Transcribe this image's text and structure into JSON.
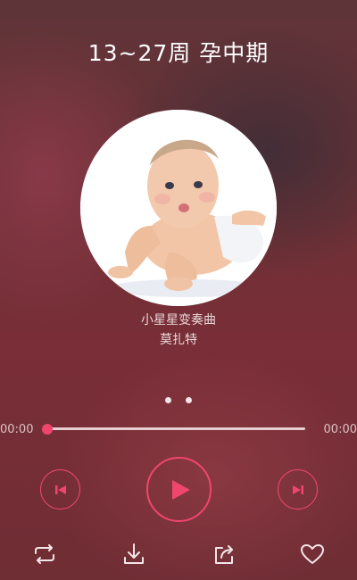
{
  "header": {
    "title": "13~27周 孕中期"
  },
  "track": {
    "cover_icon": "baby-photo",
    "song_title": "小星星变奏曲",
    "artist": "莫扎特"
  },
  "pager": {
    "count": 2
  },
  "progress": {
    "current_time": "00:00",
    "total_time": "00:00",
    "fraction": 0
  },
  "controls": {
    "prev_icon": "skip-previous-icon",
    "play_icon": "play-icon",
    "next_icon": "skip-next-icon"
  },
  "actions": [
    {
      "icon": "repeat-icon"
    },
    {
      "icon": "download-icon"
    },
    {
      "icon": "share-icon"
    },
    {
      "icon": "heart-icon"
    }
  ],
  "colors": {
    "accent": "#f0466e",
    "track": "#e6cfd3"
  }
}
